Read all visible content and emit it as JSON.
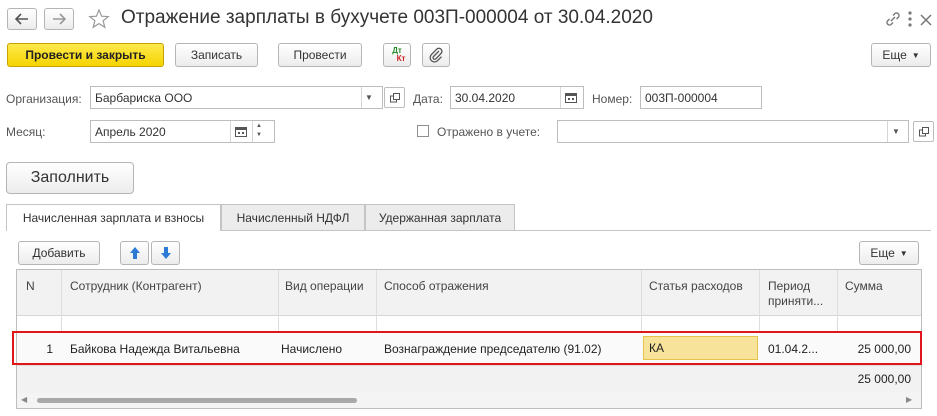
{
  "title": "Отражение зарплаты в бухучете 003П-000004 от 30.04.2020",
  "toolbar": {
    "post_close": "Провести и закрыть",
    "save": "Записать",
    "post": "Провести",
    "dtkt_top": "Дт",
    "dtkt_bottom": "Кт",
    "more": "Еще"
  },
  "form": {
    "org_label": "Организация:",
    "org_value": "Барбариска ООО",
    "date_label": "Дата:",
    "date_value": "30.04.2020",
    "number_label": "Номер:",
    "number_value": "003П-000004",
    "month_label": "Месяц:",
    "month_value": "Апрель 2020",
    "reflected_label": "Отражено в учете:",
    "reflected_value": ""
  },
  "fill_button": "Заполнить",
  "tabs": [
    "Начисленная зарплата и взносы",
    "Начисленный НДФЛ",
    "Удержанная зарплата"
  ],
  "table_toolbar": {
    "add": "Добавить",
    "more": "Еще"
  },
  "columns": {
    "n": "N",
    "employee": "Сотрудник (Контрагент)",
    "operation": "Вид операции",
    "method": "Способ отражения",
    "expense": "Статья расходов",
    "period_line1": "Период",
    "period_line2": "приняти...",
    "sum": "Сумма"
  },
  "rows": [
    {
      "n": "1",
      "employee": "Байкова Надежда Витальевна",
      "operation": "Начислено",
      "method": "Вознаграждение председателю (91.02)",
      "expense": "КА",
      "period": "01.04.2...",
      "sum": "25 000,00"
    }
  ],
  "total": "25 000,00",
  "colors": {
    "primary_button": "#f5d400",
    "highlight_border": "#e0161b",
    "selected_cell": "#f7e39a",
    "arrow_blue": "#2a7ad6"
  }
}
